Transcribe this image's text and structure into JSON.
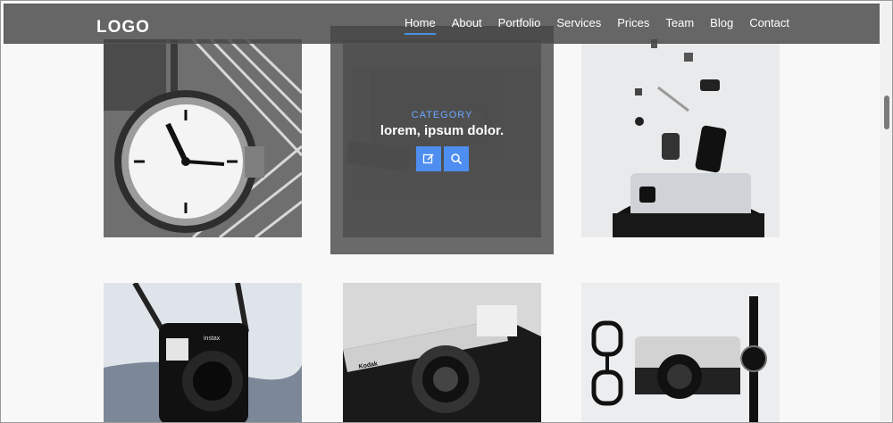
{
  "header": {
    "logo": "LOGO",
    "nav": [
      {
        "label": "Home",
        "active": true
      },
      {
        "label": "About"
      },
      {
        "label": "Portfolio"
      },
      {
        "label": "Services"
      },
      {
        "label": "Prices"
      },
      {
        "label": "Team"
      },
      {
        "label": "Blog"
      },
      {
        "label": "Contact"
      }
    ]
  },
  "portfolio": {
    "hover_card": {
      "category": "CATEGORY",
      "title": "lorem, ipsum dolor.",
      "edit_icon": "edit-icon",
      "search_icon": "search-icon"
    }
  }
}
